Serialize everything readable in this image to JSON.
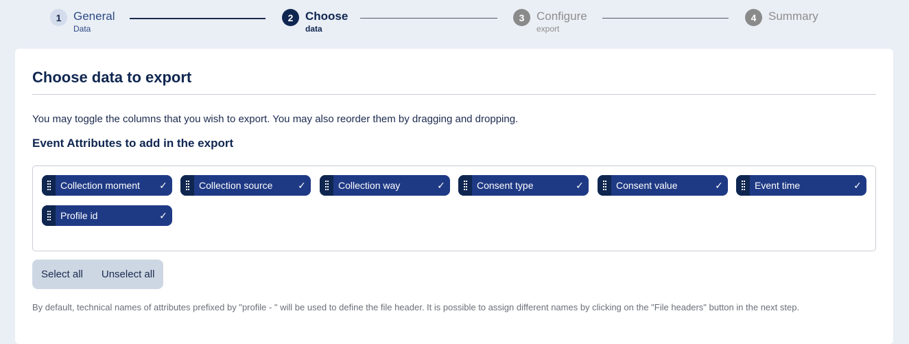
{
  "stepper": {
    "steps": [
      {
        "number": "1",
        "title": "General",
        "subtitle": "Data",
        "state": "done"
      },
      {
        "number": "2",
        "title": "Choose",
        "subtitle": "data",
        "state": "active"
      },
      {
        "number": "3",
        "title": "Configure",
        "subtitle": "export",
        "state": "todo"
      },
      {
        "number": "4",
        "title": "Summary",
        "subtitle": "",
        "state": "todo"
      }
    ]
  },
  "main": {
    "title": "Choose data to export",
    "intro": "You may toggle the columns that you wish to export. You may also reorder them by dragging and dropping.",
    "section_title": "Event Attributes to add in the export",
    "attributes": [
      {
        "label": "Collection moment",
        "checked": true
      },
      {
        "label": "Collection source",
        "checked": true
      },
      {
        "label": "Collection way",
        "checked": true
      },
      {
        "label": "Consent type",
        "checked": true
      },
      {
        "label": "Consent value",
        "checked": true
      },
      {
        "label": "Event time",
        "checked": true
      },
      {
        "label": "Profile id",
        "checked": true
      }
    ],
    "check_glyph": "✓",
    "select_all_label": "Select all",
    "unselect_all_label": "Unselect all",
    "footnote": "By default, technical names of attributes prefixed by \"profile - \" will be used to define the file header. It is possible to assign different names by clicking on the \"File headers\" button in the next step."
  },
  "colors": {
    "chip_bg": "#1f3a85",
    "chip_handle": "#0f2650",
    "active_step": "#0f2650",
    "page_bg": "#eaeef5"
  }
}
